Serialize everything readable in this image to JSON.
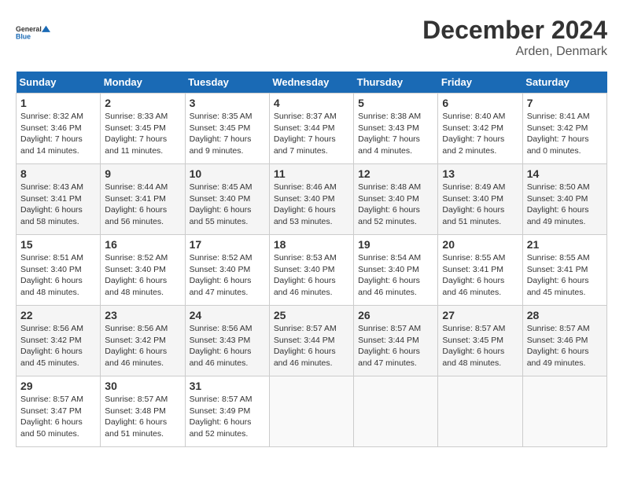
{
  "logo": {
    "line1": "General",
    "line2": "Blue"
  },
  "title": "December 2024",
  "location": "Arden, Denmark",
  "days_of_week": [
    "Sunday",
    "Monday",
    "Tuesday",
    "Wednesday",
    "Thursday",
    "Friday",
    "Saturday"
  ],
  "weeks": [
    [
      {
        "day": "1",
        "sunrise": "Sunrise: 8:32 AM",
        "sunset": "Sunset: 3:46 PM",
        "daylight": "Daylight: 7 hours and 14 minutes."
      },
      {
        "day": "2",
        "sunrise": "Sunrise: 8:33 AM",
        "sunset": "Sunset: 3:45 PM",
        "daylight": "Daylight: 7 hours and 11 minutes."
      },
      {
        "day": "3",
        "sunrise": "Sunrise: 8:35 AM",
        "sunset": "Sunset: 3:45 PM",
        "daylight": "Daylight: 7 hours and 9 minutes."
      },
      {
        "day": "4",
        "sunrise": "Sunrise: 8:37 AM",
        "sunset": "Sunset: 3:44 PM",
        "daylight": "Daylight: 7 hours and 7 minutes."
      },
      {
        "day": "5",
        "sunrise": "Sunrise: 8:38 AM",
        "sunset": "Sunset: 3:43 PM",
        "daylight": "Daylight: 7 hours and 4 minutes."
      },
      {
        "day": "6",
        "sunrise": "Sunrise: 8:40 AM",
        "sunset": "Sunset: 3:42 PM",
        "daylight": "Daylight: 7 hours and 2 minutes."
      },
      {
        "day": "7",
        "sunrise": "Sunrise: 8:41 AM",
        "sunset": "Sunset: 3:42 PM",
        "daylight": "Daylight: 7 hours and 0 minutes."
      }
    ],
    [
      {
        "day": "8",
        "sunrise": "Sunrise: 8:43 AM",
        "sunset": "Sunset: 3:41 PM",
        "daylight": "Daylight: 6 hours and 58 minutes."
      },
      {
        "day": "9",
        "sunrise": "Sunrise: 8:44 AM",
        "sunset": "Sunset: 3:41 PM",
        "daylight": "Daylight: 6 hours and 56 minutes."
      },
      {
        "day": "10",
        "sunrise": "Sunrise: 8:45 AM",
        "sunset": "Sunset: 3:40 PM",
        "daylight": "Daylight: 6 hours and 55 minutes."
      },
      {
        "day": "11",
        "sunrise": "Sunrise: 8:46 AM",
        "sunset": "Sunset: 3:40 PM",
        "daylight": "Daylight: 6 hours and 53 minutes."
      },
      {
        "day": "12",
        "sunrise": "Sunrise: 8:48 AM",
        "sunset": "Sunset: 3:40 PM",
        "daylight": "Daylight: 6 hours and 52 minutes."
      },
      {
        "day": "13",
        "sunrise": "Sunrise: 8:49 AM",
        "sunset": "Sunset: 3:40 PM",
        "daylight": "Daylight: 6 hours and 51 minutes."
      },
      {
        "day": "14",
        "sunrise": "Sunrise: 8:50 AM",
        "sunset": "Sunset: 3:40 PM",
        "daylight": "Daylight: 6 hours and 49 minutes."
      }
    ],
    [
      {
        "day": "15",
        "sunrise": "Sunrise: 8:51 AM",
        "sunset": "Sunset: 3:40 PM",
        "daylight": "Daylight: 6 hours and 48 minutes."
      },
      {
        "day": "16",
        "sunrise": "Sunrise: 8:52 AM",
        "sunset": "Sunset: 3:40 PM",
        "daylight": "Daylight: 6 hours and 48 minutes."
      },
      {
        "day": "17",
        "sunrise": "Sunrise: 8:52 AM",
        "sunset": "Sunset: 3:40 PM",
        "daylight": "Daylight: 6 hours and 47 minutes."
      },
      {
        "day": "18",
        "sunrise": "Sunrise: 8:53 AM",
        "sunset": "Sunset: 3:40 PM",
        "daylight": "Daylight: 6 hours and 46 minutes."
      },
      {
        "day": "19",
        "sunrise": "Sunrise: 8:54 AM",
        "sunset": "Sunset: 3:40 PM",
        "daylight": "Daylight: 6 hours and 46 minutes."
      },
      {
        "day": "20",
        "sunrise": "Sunrise: 8:55 AM",
        "sunset": "Sunset: 3:41 PM",
        "daylight": "Daylight: 6 hours and 46 minutes."
      },
      {
        "day": "21",
        "sunrise": "Sunrise: 8:55 AM",
        "sunset": "Sunset: 3:41 PM",
        "daylight": "Daylight: 6 hours and 45 minutes."
      }
    ],
    [
      {
        "day": "22",
        "sunrise": "Sunrise: 8:56 AM",
        "sunset": "Sunset: 3:42 PM",
        "daylight": "Daylight: 6 hours and 45 minutes."
      },
      {
        "day": "23",
        "sunrise": "Sunrise: 8:56 AM",
        "sunset": "Sunset: 3:42 PM",
        "daylight": "Daylight: 6 hours and 46 minutes."
      },
      {
        "day": "24",
        "sunrise": "Sunrise: 8:56 AM",
        "sunset": "Sunset: 3:43 PM",
        "daylight": "Daylight: 6 hours and 46 minutes."
      },
      {
        "day": "25",
        "sunrise": "Sunrise: 8:57 AM",
        "sunset": "Sunset: 3:44 PM",
        "daylight": "Daylight: 6 hours and 46 minutes."
      },
      {
        "day": "26",
        "sunrise": "Sunrise: 8:57 AM",
        "sunset": "Sunset: 3:44 PM",
        "daylight": "Daylight: 6 hours and 47 minutes."
      },
      {
        "day": "27",
        "sunrise": "Sunrise: 8:57 AM",
        "sunset": "Sunset: 3:45 PM",
        "daylight": "Daylight: 6 hours and 48 minutes."
      },
      {
        "day": "28",
        "sunrise": "Sunrise: 8:57 AM",
        "sunset": "Sunset: 3:46 PM",
        "daylight": "Daylight: 6 hours and 49 minutes."
      }
    ],
    [
      {
        "day": "29",
        "sunrise": "Sunrise: 8:57 AM",
        "sunset": "Sunset: 3:47 PM",
        "daylight": "Daylight: 6 hours and 50 minutes."
      },
      {
        "day": "30",
        "sunrise": "Sunrise: 8:57 AM",
        "sunset": "Sunset: 3:48 PM",
        "daylight": "Daylight: 6 hours and 51 minutes."
      },
      {
        "day": "31",
        "sunrise": "Sunrise: 8:57 AM",
        "sunset": "Sunset: 3:49 PM",
        "daylight": "Daylight: 6 hours and 52 minutes."
      },
      null,
      null,
      null,
      null
    ]
  ]
}
